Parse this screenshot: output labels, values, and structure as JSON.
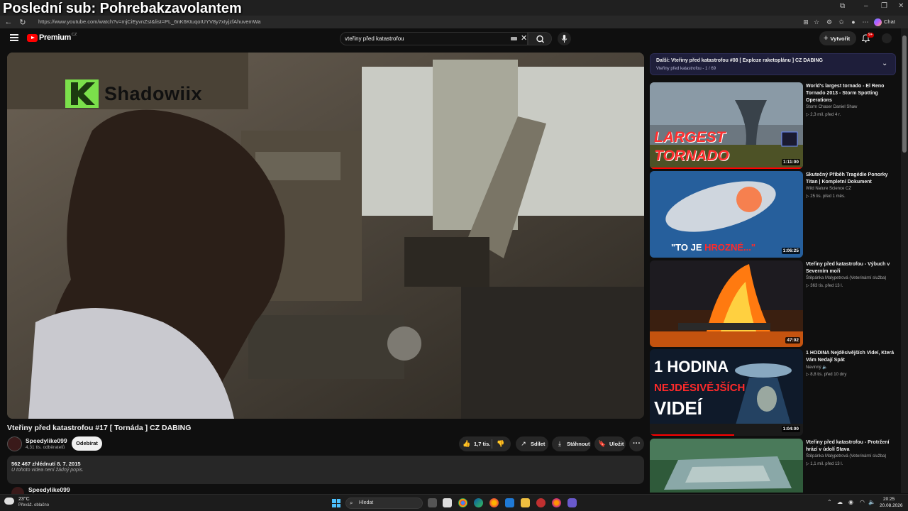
{
  "overlay": {
    "text": "Poslední sub: Pohrebakzavolantem"
  },
  "browser": {
    "url": "https://www.youtube.com/watch?v=mjCiEyvnZsI&list=PL_6nK6KtuqoIUYV8y7xIyjzfAhuvemWa",
    "chat_label": "Chat"
  },
  "header": {
    "logo_text": "Premium",
    "logo_region": "CZ",
    "search_value": "vteřiny před katastrofou",
    "create_label": "Vytvořit",
    "notification_badge": "9+"
  },
  "video": {
    "watermark": "Shadowiix",
    "title": "Vteřiny před katastrofou #17 [ Tornáda ] CZ DABING",
    "channel": "Speedylike099",
    "subscribers": "4,31 tis. odběratelů",
    "subscribe_label": "Odebírat",
    "likes": "1,7 tis.",
    "share_label": "Sdílet",
    "download_label": "Stáhnout",
    "save_label": "Uložit",
    "more_label": "···",
    "views_date": "562 467 zhlédnutí  8. 7. 2015",
    "description": "U tohoto videa není žádný popis.",
    "comment_author": "Speedylike099"
  },
  "playlist": {
    "next_label": "Další: Vteřiny před katastrofou #08 [ Exploze raketoplánu ] CZ DABING",
    "sub": "Vteřiny před katastrofou - 1 / 69"
  },
  "recommendations": [
    {
      "title": "World's largest tornado - El Reno Tornado 2013 - Storm Spotting Operations",
      "channel": "Storm Chaser Daniel Shaw",
      "meta": "▷ 2,3 mil.  před 4 r.",
      "duration": "1:11:00",
      "thumb_text_1": "LARGEST",
      "thumb_text_2": "TORNADO"
    },
    {
      "title": "Skutečný Příběh Tragédie Ponorky Titan | Kompletní Dokument",
      "channel": "Wild Nature Science CZ",
      "meta": "▷ 25 tis.  před 1 měs.",
      "duration": "1:06:25",
      "thumb_text_1": "\"TO JE ",
      "thumb_text_2": "HROZNÉ...\""
    },
    {
      "title": "Vteřiny před katastrofou - Výbuch v Severním moři",
      "channel": "Štěpánka Malypetrová (Veterinární služba)",
      "meta": "▷ 363 tis.  před 13 l.",
      "duration": "47:02"
    },
    {
      "title": "1 HODINA Nejděsivějších Videí, Která Vám Nedají Spát",
      "channel": "Nevinný 🔈",
      "meta": "▷ 8,8 tis.  před 10 dny",
      "duration": "1:04:00",
      "thumb_text_1": "1 HODINA",
      "thumb_text_2": "NEJDĚSIVĚJŠÍCH",
      "thumb_text_3": "VIDEÍ"
    },
    {
      "title": "Vteřiny před katastrofou - Protržení hrází v údolí Stava",
      "channel": "Štěpánka Malypetrová (Veterinární služba)",
      "meta": "▷ 1,1 mil.  před 13 l."
    }
  ],
  "taskbar": {
    "temp": "23°C",
    "weather": "Převáž. oblačno",
    "search_label": "Hledat",
    "time": "20:25",
    "date": "20.08.2026"
  },
  "colors": {
    "accent_red": "#ff0000",
    "bg": "#0f0f0f",
    "playlist_bg": "#1e1e3a",
    "watermark_green": "#7be04b"
  }
}
